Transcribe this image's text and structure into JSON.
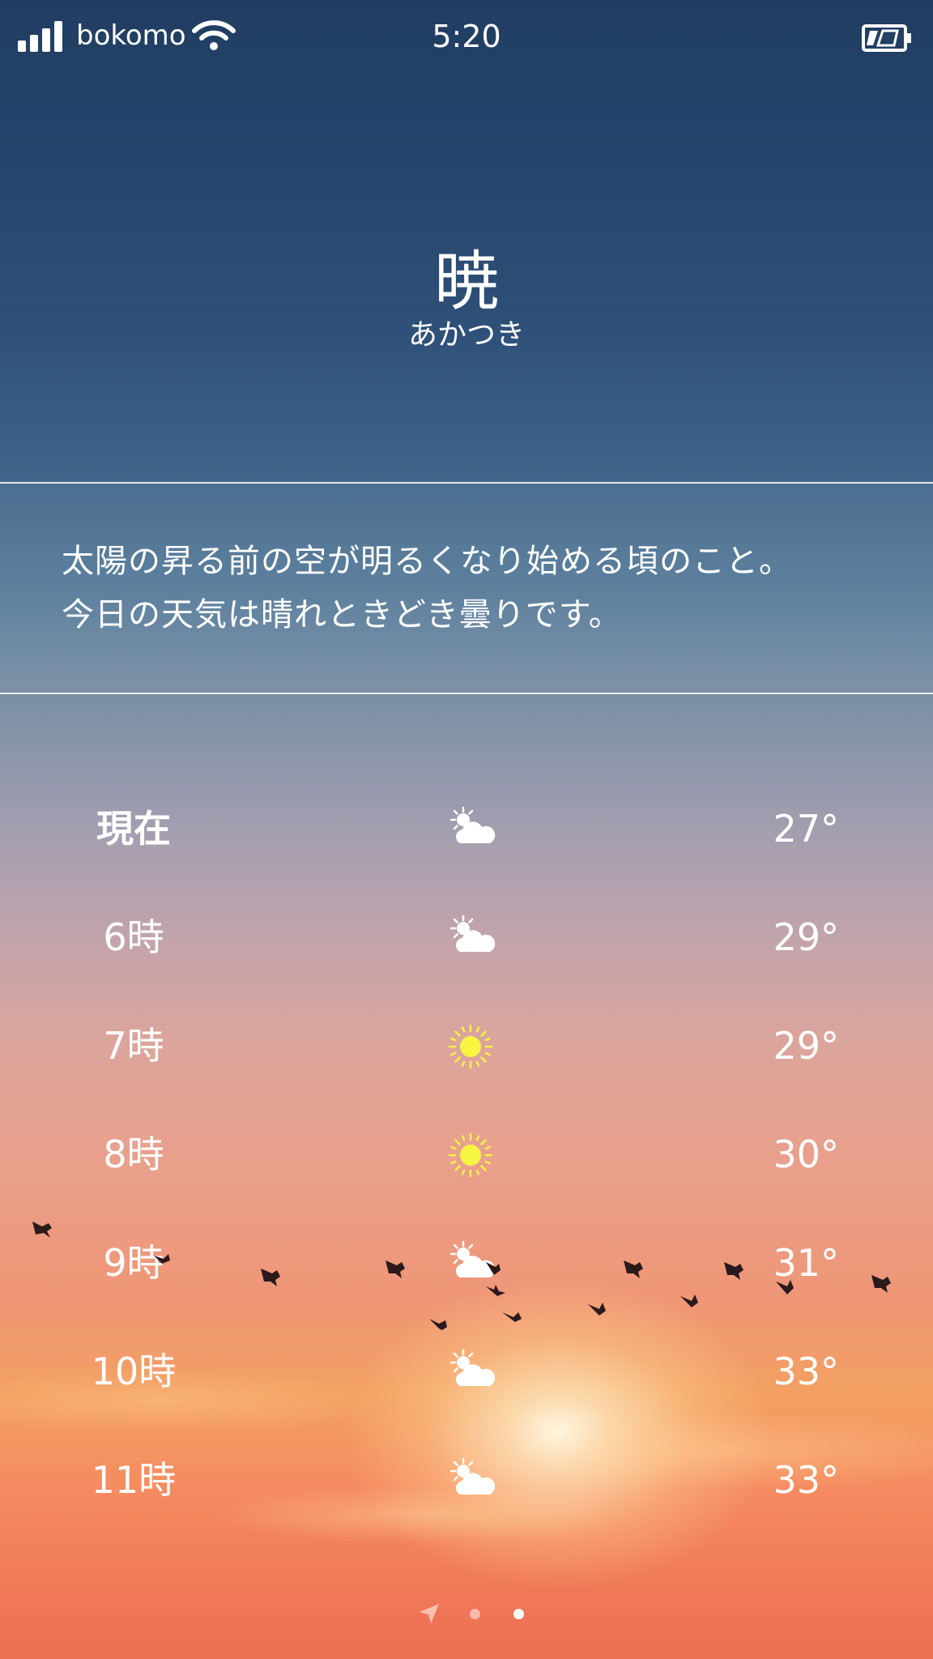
{
  "status_bar": {
    "carrier": "bokomo",
    "time": "5:20",
    "signal_icon": "cellular-signal-icon",
    "wifi_icon": "wifi-icon",
    "battery_icon": "battery-icon"
  },
  "header": {
    "title": "暁",
    "reading": "あかつき"
  },
  "description": {
    "line1": "太陽の昇る前の空が明るくなり始める頃のこと。",
    "line2": "今日の天気は晴れときどき曇りです。"
  },
  "forecast": [
    {
      "hour": "現在",
      "icon": "partly-cloudy-icon",
      "temp": "27°"
    },
    {
      "hour": "6時",
      "icon": "partly-cloudy-icon",
      "temp": "29°"
    },
    {
      "hour": "7時",
      "icon": "sunny-icon",
      "temp": "29°"
    },
    {
      "hour": "8時",
      "icon": "sunny-icon",
      "temp": "30°"
    },
    {
      "hour": "9時",
      "icon": "partly-cloudy-icon",
      "temp": "31°"
    },
    {
      "hour": "10時",
      "icon": "partly-cloudy-icon",
      "temp": "33°"
    },
    {
      "hour": "11時",
      "icon": "partly-cloudy-icon",
      "temp": "33°"
    }
  ],
  "pager": {
    "location_icon": "location-arrow-icon",
    "pages": 2,
    "active_page": 2
  },
  "colors": {
    "sun_yellow": "#f5f542",
    "text": "#ffffff",
    "sky_top": "#213d62",
    "sky_bottom": "#ec6f52"
  }
}
